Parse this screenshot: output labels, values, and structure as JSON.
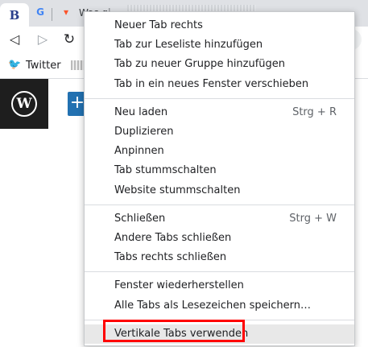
{
  "tabs": {
    "active_favicon": "B",
    "google_favicon": "G",
    "brave_favicon": "▾",
    "third_tab_title": "Was gi"
  },
  "toolbar": {
    "back_icon": "◁",
    "forward_icon": "▷",
    "reload_icon": "↻"
  },
  "bookmarks": {
    "twitter_label": "Twitter"
  },
  "page": {
    "wp_logo": "W",
    "add_button": "+"
  },
  "menu": {
    "groups": [
      {
        "items": [
          {
            "label": "Neuer Tab rechts"
          },
          {
            "label": "Tab zur Leseliste hinzufügen"
          },
          {
            "label": "Tab zu neuer Gruppe hinzufügen"
          },
          {
            "label": "Tab in ein neues Fenster verschieben"
          }
        ]
      },
      {
        "items": [
          {
            "label": "Neu laden",
            "shortcut": "Strg + R"
          },
          {
            "label": "Duplizieren"
          },
          {
            "label": "Anpinnen"
          },
          {
            "label": "Tab stummschalten"
          },
          {
            "label": "Website stummschalten"
          }
        ]
      },
      {
        "items": [
          {
            "label": "Schließen",
            "shortcut": "Strg + W"
          },
          {
            "label": "Andere Tabs schließen"
          },
          {
            "label": "Tabs rechts schließen"
          }
        ]
      },
      {
        "items": [
          {
            "label": "Fenster wiederherstellen"
          },
          {
            "label": "Alle Tabs als Lesezeichen speichern…"
          }
        ]
      },
      {
        "items": [
          {
            "label": "Vertikale Tabs verwenden",
            "hovered": true
          }
        ]
      }
    ]
  },
  "colors": {
    "highlight_box": "#ff0000",
    "hover_background": "#e8e8e8",
    "wp_blue": "#2271b1"
  }
}
